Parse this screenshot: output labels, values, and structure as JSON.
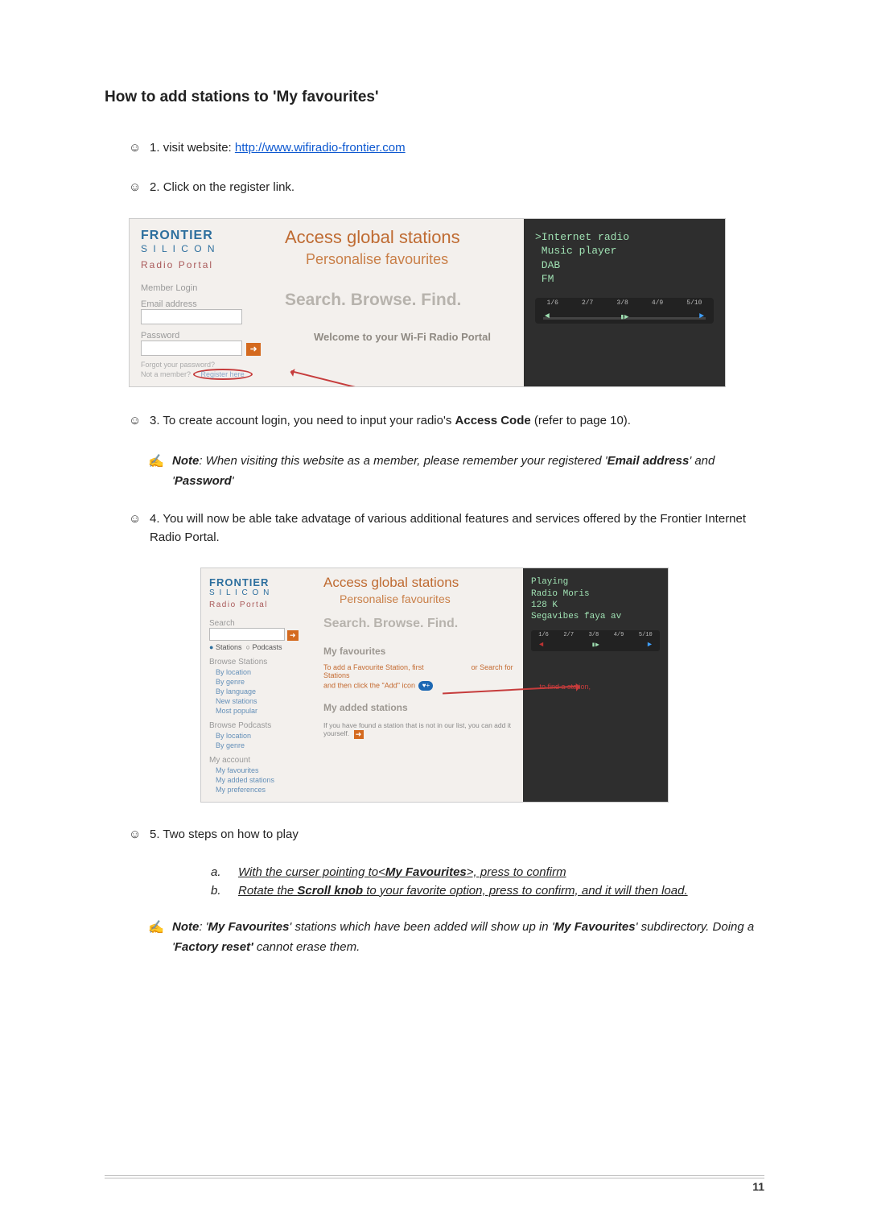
{
  "heading": "How to add stations to 'My favourites'",
  "steps": {
    "s1_label": "1.",
    "s1_text_before": "visit website: ",
    "s1_link": "http://www.wifiradio-frontier.com",
    "s2_label": "2.",
    "s2_text": "Click on the register link.",
    "s3_label": "3.",
    "s3_text_before": "To create account login, you need to input your radio's ",
    "s3_bold": "Access Code",
    "s3_text_after": " (refer to page 10).",
    "s4_label": "4.",
    "s4_text": "You will now be able take advatage of various additional features and services offered  by the Frontier Internet Radio Portal.",
    "s5_label": "5.",
    "s5_text": "Two steps on how to play"
  },
  "note1": {
    "label": "Note",
    "before": ": When visiting this website as a member, please remember your registered '",
    "bold_email": "Email address",
    "mid": "' and '",
    "bold_pwd": "Password",
    "after": "'"
  },
  "substeps": {
    "a_letter": "a.",
    "a_before": "With the curser pointing to<",
    "a_bold": "My Favourites",
    "a_after": ">, press to confirm",
    "b_letter": "b.",
    "b_before": "Rotate the ",
    "b_bold": "Scroll knob",
    "b_after": " to your favorite option, press to confirm, and it will then load."
  },
  "note2": {
    "label": "Note",
    "before1": ": '",
    "bold1": "My Favourites",
    "mid1": "' stations which have been added will show up in '",
    "bold2": "My Favourites",
    "after1": "'  subdirectory. Doing a '",
    "bold3": "Factory reset'",
    "after2": " cannot erase them."
  },
  "shot1": {
    "brand_top": "FRONTIER",
    "brand_bot": "S I L I C O N",
    "brand_sub": "Radio Portal",
    "member_login": "Member Login",
    "email_lbl": "Email address",
    "password_lbl": "Password",
    "go": "➜",
    "forgot": "Forgot your password?",
    "not_member": "Not a member?",
    "register": "Register here",
    "h1": "Access global stations",
    "h2": "Personalise favourites",
    "h3": "Search. Browse. Find.",
    "welcome": "Welcome to your Wi-Fi Radio Portal",
    "device": {
      "l1": ">Internet radio",
      "l2": " Music player",
      "l3": " DAB",
      "l4": " FM",
      "ticks": [
        "1/6",
        "2/7",
        "3/8",
        "4/9",
        "5/10"
      ],
      "prev": "◄",
      "play": "▮▶",
      "next": "►"
    }
  },
  "shot2": {
    "brand_top": "FRONTIER",
    "brand_bot": "S I L I C O N",
    "brand_sub": "Radio Portal",
    "search_hd": "Search",
    "go": "➜",
    "radio_stations": "Stations",
    "radio_podcasts": "Podcasts",
    "browse_st_hd": "Browse Stations",
    "bs1": "By location",
    "bs2": "By genre",
    "bs3": "By language",
    "bs4": "New stations",
    "bs5": "Most popular",
    "browse_pc_hd": "Browse Podcasts",
    "bp1": "By location",
    "bp2": "By genre",
    "myacc_hd": "My account",
    "ma1": "My favourites",
    "ma2": "My added stations",
    "ma3": "My preferences",
    "h1": "Access global stations",
    "h2": "Personalise favourites",
    "h3": "Search. Browse. Find.",
    "fav_hd": "My favourites",
    "fav_txt": "To add a Favourite Station, first",
    "fav_txt_search": "or Search for Stations",
    "fav_txt2": "and then    click the \"Add\" icon",
    "find_txt": "to find a station,",
    "added_hd": "My added stations",
    "added_txt": "If you have found a station that is not in our list, you can add it yourself.",
    "device": {
      "l1": "Playing",
      "l2": "Radio Moris",
      "l3": "128 K",
      "l4": "Segavibes faya av",
      "ticks": [
        "1/6",
        "2/7",
        "3/8",
        "4/9",
        "5/10"
      ],
      "prev": "◄",
      "play": "▮▶",
      "next": "►"
    }
  },
  "footer": {
    "page": "11"
  }
}
